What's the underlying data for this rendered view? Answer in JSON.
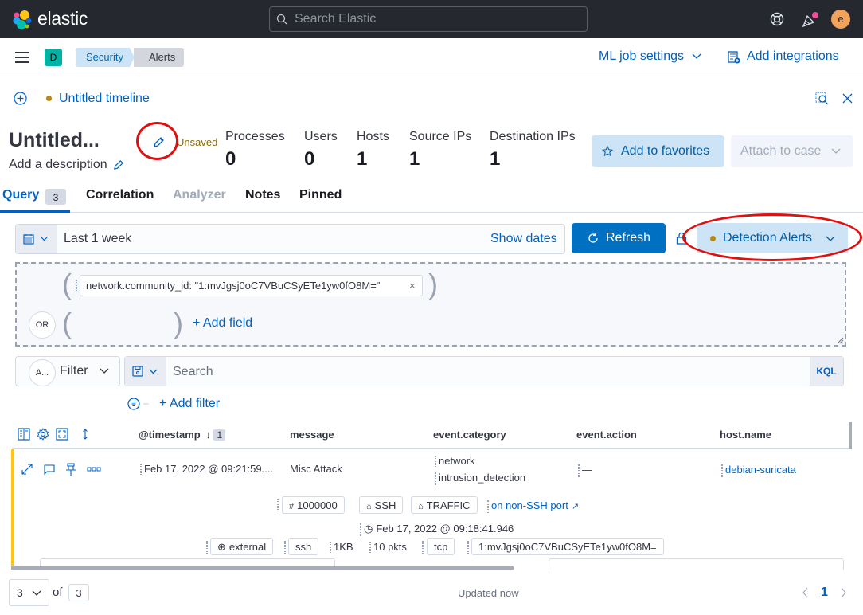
{
  "topbar": {
    "brand": "elastic",
    "search_placeholder": "Search Elastic",
    "help_icon": "help-lifebuoy-icon",
    "news_icon": "newsfeed-icon",
    "user_initial": "e"
  },
  "subheader": {
    "space_initial": "D",
    "breadcrumbs": [
      "Security",
      "Alerts"
    ],
    "ml_job_settings": "ML job settings",
    "add_integrations": "Add integrations"
  },
  "timeline": {
    "tab_title": "Untitled timeline",
    "title": "Untitled...",
    "description_placeholder": "Add a description",
    "save_status": "Unsaved",
    "stats": [
      {
        "label": "Processes",
        "value": "0"
      },
      {
        "label": "Users",
        "value": "0"
      },
      {
        "label": "Hosts",
        "value": "1"
      },
      {
        "label": "Source IPs",
        "value": "1"
      },
      {
        "label": "Destination IPs",
        "value": "1"
      }
    ],
    "add_to_favorites": "Add to favorites",
    "attach_to_case": "Attach to case",
    "tabs": [
      {
        "label": "Query",
        "badge": "3",
        "active": true
      },
      {
        "label": "Correlation"
      },
      {
        "label": "Analyzer",
        "disabled": true
      },
      {
        "label": "Notes"
      },
      {
        "label": "Pinned"
      }
    ]
  },
  "query": {
    "date_range": "Last 1 week",
    "show_dates": "Show dates",
    "refresh": "Refresh",
    "data_view": "Detection Alerts",
    "provider_field": "network.community_id: \"1:mvJgsj0oC7VBuCSyETe1yw0fO8M=\"",
    "or_label": "OR",
    "add_field": "+ Add field",
    "filter_badge": "A...",
    "filter_label": "Filter",
    "search_placeholder": "Search",
    "language": "KQL",
    "add_filter": "+ Add filter"
  },
  "table": {
    "columns": [
      "@timestamp",
      "message",
      "event.category",
      "event.action",
      "host.name"
    ],
    "sort_badge": "1",
    "rows": [
      {
        "timestamp": "Feb 17, 2022 @ 09:21:59....",
        "message": "Misc Attack",
        "event_category": [
          "network",
          "intrusion_detection"
        ],
        "event_action": "—",
        "host_name": "debian-suricata",
        "detail": {
          "signature_id": "1000000",
          "tags": [
            "SSH",
            "TRAFFIC"
          ],
          "signature_link": "on non-SSH port",
          "time": "Feb 17, 2022 @ 09:18:41.946",
          "direction": "external",
          "protocol": "ssh",
          "bytes": "1KB",
          "packets": "10 pkts",
          "transport": "tcp",
          "community_id": "1:mvJgsj0oC7VBuCSyETe1yw0fO8M="
        }
      }
    ]
  },
  "footer": {
    "rows_per_page": "3",
    "of_label": "of",
    "total": "3",
    "status": "Updated now",
    "current_page": "1"
  },
  "colors": {
    "accent": "#0061c2",
    "topbar": "#25282f",
    "alert_bar": "#fec514",
    "annotation": "#e01010"
  }
}
